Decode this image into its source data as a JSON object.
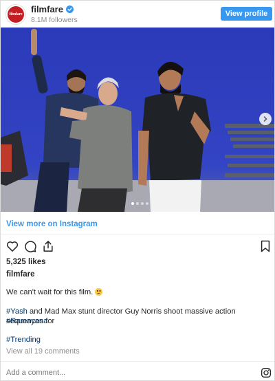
{
  "header": {
    "avatar_text": "filmfare",
    "username": "filmfare",
    "followers": "8.1M followers",
    "view_profile_label": "View profile"
  },
  "photo": {
    "slide_count": 4,
    "active_slide": 1
  },
  "view_more_label": "View more on Instagram",
  "actions": {
    "like_icon": "heart-icon",
    "comment_icon": "comment-icon",
    "share_icon": "share-icon",
    "save_icon": "bookmark-icon"
  },
  "likes": "5,325 likes",
  "caption": {
    "username": "filmfare",
    "line1": "We can't wait for this film.",
    "line2_tag": "#Yash",
    "line2_text": " and Mad Max stunt director Guy Norris shoot massive action sequences for",
    "line3_tag": "#Ramayana",
    "line4_tag": "#Trending"
  },
  "view_all_comments": "View all 19 comments",
  "comment_placeholder": "Add a comment...",
  "colors": {
    "accent": "#3897f0",
    "hashtag": "#003569",
    "muted": "#8e8e8e",
    "brand_red": "#c41d23"
  }
}
